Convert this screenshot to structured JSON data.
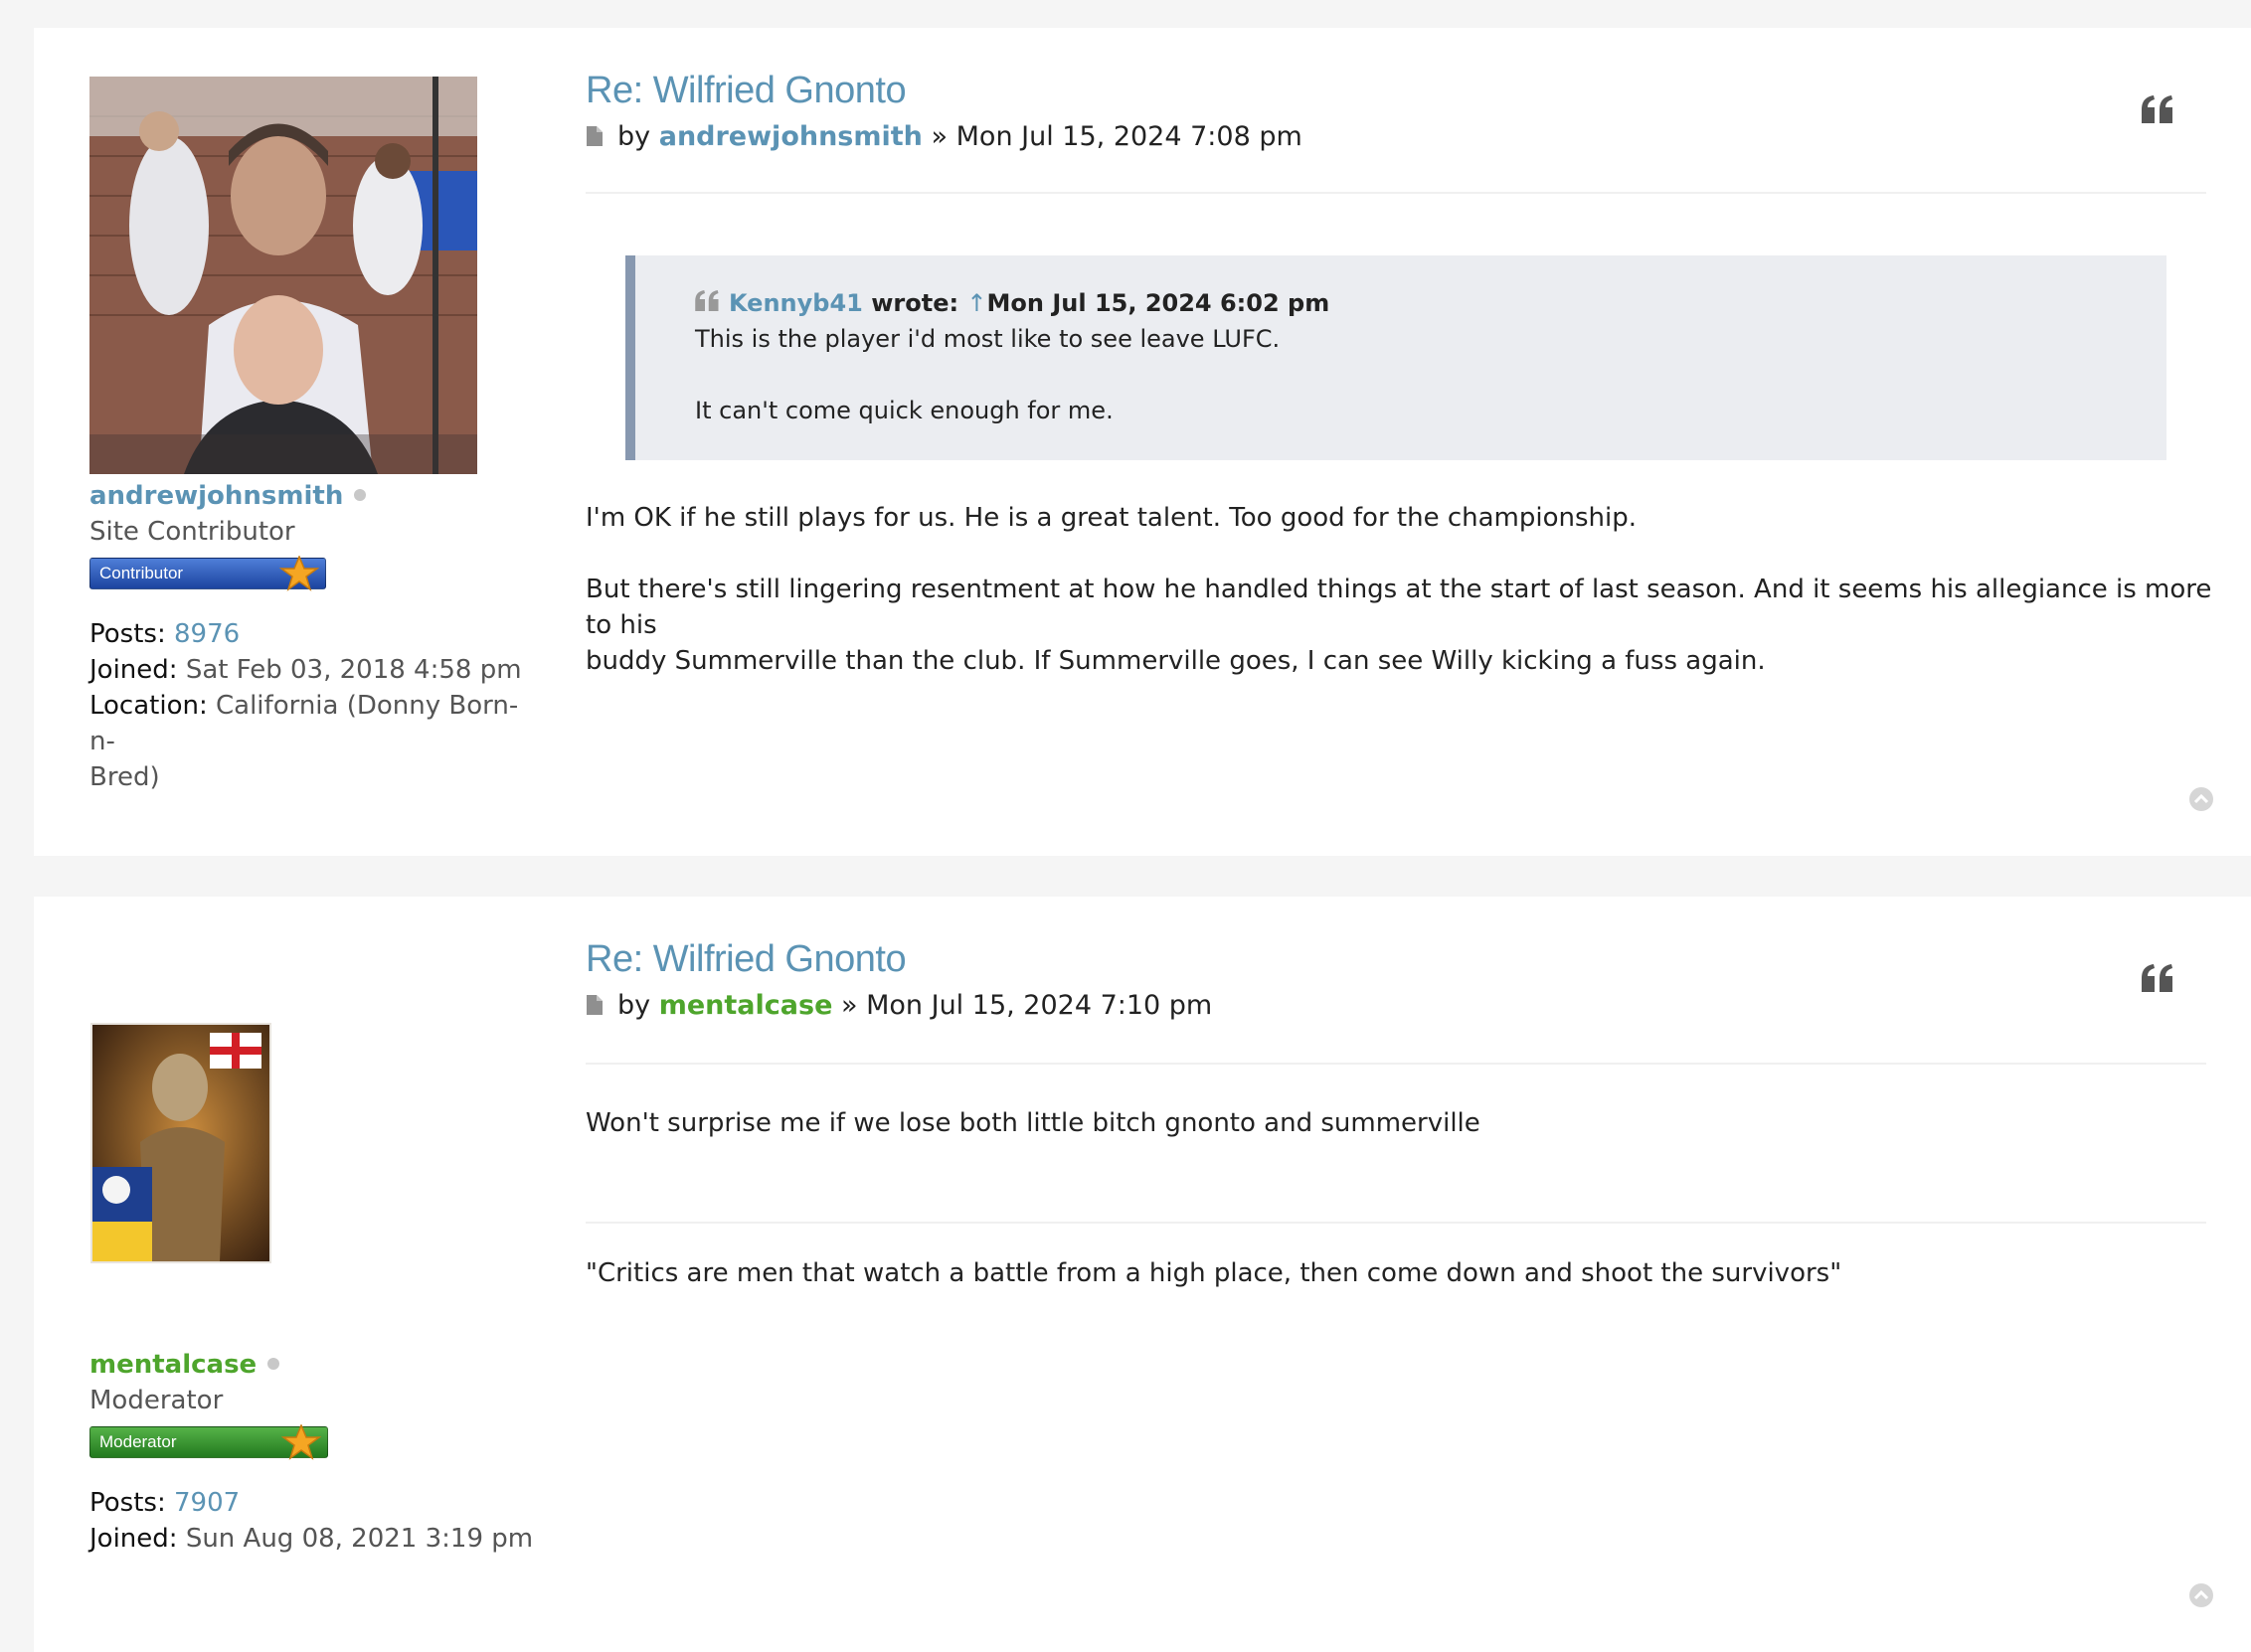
{
  "posts": [
    {
      "title": "Re: Wilfried Gnonto",
      "by_label": "by",
      "author": "andrewjohnsmith",
      "separator": "»",
      "date": "Mon Jul 15, 2024 7:08 pm",
      "user": {
        "name": "andrewjohnsmith",
        "name_color": "#5b93b4",
        "rank": "Site Contributor",
        "badge_text": "Contributor",
        "badge_color": "#2555b3",
        "fields": [
          {
            "label": "Posts:",
            "value": "8976"
          },
          {
            "label": "Joined:",
            "value": "Sat Feb 03, 2018 4:58 pm"
          },
          {
            "label": "Location:",
            "value_line1": "California (Donny Born-n-",
            "value_line2": "Bred)"
          }
        ]
      },
      "quote": {
        "author": "Kennyb41",
        "wrote": "wrote:",
        "arrow": "↑",
        "date": "Mon Jul 15, 2024 6:02 pm",
        "line1": "This is the player i'd most like to see leave LUFC.",
        "line2": "It can't come quick enough for me."
      },
      "body": {
        "p1": "I'm OK if he still plays for us. He is a great talent. Too good for the championship.",
        "p2_line1": "But there's still lingering resentment at how he handled things at the start of last season. And it seems his allegiance is more to his",
        "p2_line2": "buddy Summerville than the club. If Summerville goes, I can see Willy kicking a fuss again."
      }
    },
    {
      "title": "Re: Wilfried Gnonto",
      "by_label": "by",
      "author": "mentalcase",
      "separator": "»",
      "date": "Mon Jul 15, 2024 7:10 pm",
      "user": {
        "name": "mentalcase",
        "name_color": "#4ea52c",
        "rank": "Moderator",
        "badge_text": "Moderator",
        "badge_color": "#2f8f2a",
        "fields": [
          {
            "label": "Posts:",
            "value": "7907"
          },
          {
            "label": "Joined:",
            "value": "Sun Aug 08, 2021 3:19 pm"
          }
        ]
      },
      "body": {
        "p1": "Won't surprise me if we lose both little bitch gnonto and summerville"
      },
      "signature": "\"Critics are men that watch a battle from a high place, then come down and shoot the survivors\""
    }
  ],
  "icons": {
    "quote": "quote-icon",
    "post_file": "file-icon",
    "online_status": "offline-dot",
    "back_to_top": "chevron-up-circle-icon"
  },
  "colors": {
    "link": "#5b93b4",
    "moderator": "#4ea52c",
    "page_bg": "#f5f5f5",
    "quote_bg": "#ebedf1",
    "quote_border": "#8798b0"
  }
}
